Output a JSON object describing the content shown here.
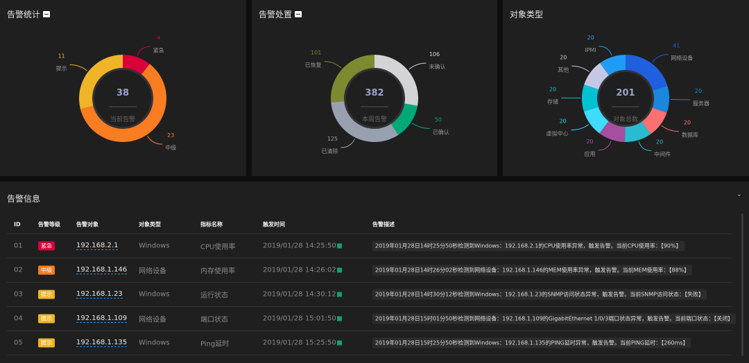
{
  "panels": [
    {
      "title": "告警统计",
      "center_value": "38",
      "center_label": "当前告警",
      "slices": [
        {
          "label": "紧急",
          "value": 4,
          "color": "#d9003a"
        },
        {
          "label": "中级",
          "value": 23,
          "color": "#fa7d22"
        },
        {
          "label": "提示",
          "value": 11,
          "color": "#f0b429"
        }
      ]
    },
    {
      "title": "告警处置",
      "center_value": "382",
      "center_label": "本周告警",
      "slices": [
        {
          "label": "未确认",
          "value": 106,
          "color": "#d3d4d6"
        },
        {
          "label": "已确认",
          "value": 50,
          "color": "#00a878"
        },
        {
          "label": "已清除",
          "value": 125,
          "color": "#98a0b0"
        },
        {
          "label": "已恢复",
          "value": 101,
          "color": "#7d8a30"
        }
      ]
    },
    {
      "title": "对象类型",
      "center_value": "201",
      "center_label": "对象总数",
      "slices": [
        {
          "label": "网络设备",
          "value": 41,
          "color": "#1f5fe0"
        },
        {
          "label": "服务器",
          "value": 20,
          "color": "#1a86dc"
        },
        {
          "label": "数据库",
          "value": 20,
          "color": "#ff7070"
        },
        {
          "label": "中间件",
          "value": 20,
          "color": "#29bcd0"
        },
        {
          "label": "应用",
          "value": 20,
          "color": "#a64fa0"
        },
        {
          "label": "虚拟中心",
          "value": 20,
          "color": "#3fdcff"
        },
        {
          "label": "存储",
          "value": 20,
          "color": "#00c2d4"
        },
        {
          "label": "其他",
          "value": 20,
          "color": "#c5c8e4"
        },
        {
          "label": "IPMI",
          "value": 20,
          "color": "#1f9cf5"
        }
      ]
    }
  ],
  "alerts": {
    "title": "告警信息",
    "headers": [
      "ID",
      "告警等级",
      "告警对象",
      "对象类型",
      "指标名称",
      "触发时间",
      "告警描述"
    ],
    "level_colors": {
      "紧急": "#d9003a",
      "中级": "#fa7d22",
      "提示": "#f0b429"
    },
    "rows": [
      {
        "id": "01",
        "level": "紧急",
        "target": "192.168.2.1",
        "type": "Windows",
        "metric": "CPU使用率",
        "time": "2019/01/28 14:25:50",
        "desc": "2019年01月28日14时25分50秒检测到Windows：192.168.2.1的CPU使用率异常，触发告警。当前CPU使用率：【90%】"
      },
      {
        "id": "02",
        "level": "中级",
        "target": "192.168.1.146",
        "type": "网络设备",
        "metric": "内存使用率",
        "time": "2019/01/28 14:26:02",
        "desc": "2019年01月28日14时26分02秒检测到网络设备：192.168.1.146的MEM使用率异常，触发告警。当前MEM使用率：【88%】"
      },
      {
        "id": "03",
        "level": "提示",
        "target": "192.168.1.23",
        "type": "Windows",
        "metric": "运行状态",
        "time": "2019/01/28 14:30:12",
        "desc": "2019年01月28日14时30分12秒检测到Windows：192.168.1.23的SNMP访问状态异常，触发告警。当前SNMP访问状态：【失败】"
      },
      {
        "id": "04",
        "level": "提示",
        "target": "192.168.1.109",
        "type": "网络设备",
        "metric": "端口状态",
        "time": "2019/01/28 15:01:50",
        "desc": "2019年01月28日15时01分50秒检测到网络设备：192.168.1.109的GigabitEthernet 1/0/3端口状态异常，触发告警。当前端口状态：【关闭】"
      },
      {
        "id": "05",
        "level": "提示",
        "target": "192.168.1.135",
        "type": "Windows",
        "metric": "Ping延时",
        "time": "2019/01/28 15:25:50",
        "desc": "2019年01月28日15时25分50秒检测到Windows：192.168.1.135的PING延时异常，触发告警。当前PING延时：【260ms】"
      }
    ]
  }
}
